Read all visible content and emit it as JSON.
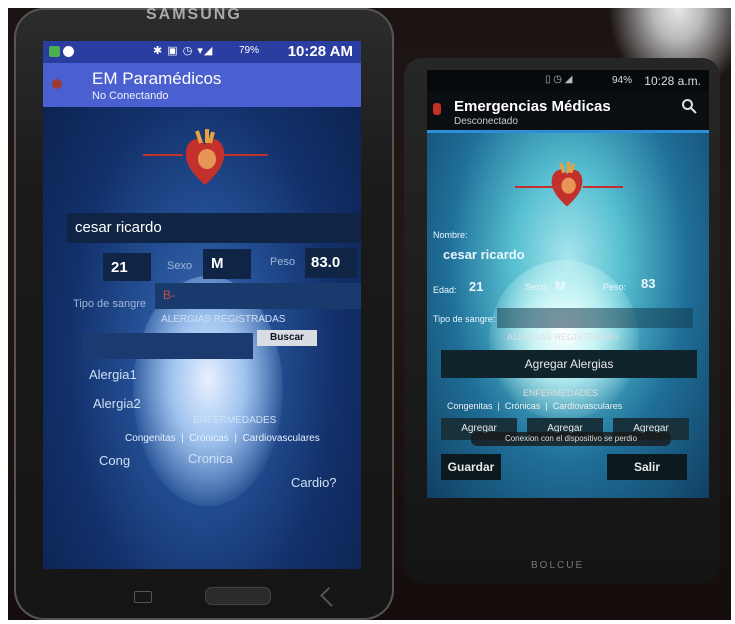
{
  "phone1": {
    "brand": "SAMSUNG",
    "status": {
      "icons": "✱ ▣ ◷ ▾◢",
      "battery": "79%",
      "time": "10:28 AM"
    },
    "appbar": {
      "title": "EM Paramédicos",
      "subtitle": "No Conectando"
    },
    "form": {
      "name_value": "cesar ricardo",
      "age_value": "21",
      "sex_label": "Sexo",
      "sex_value": "M",
      "weight_label": "Peso",
      "weight_value": "83.0",
      "blood_label": "Tipo de sangre",
      "blood_value": "B-",
      "allergies_caption": "ALERGIAS REGISTRADAS",
      "search_button": "Buscar",
      "allergy1": "Alergia1",
      "allergy2": "Alergia2",
      "diseases_caption": "ENFERMEDADES",
      "categories": "Congenitas  |  Crónicas  |  Cardiovasculares",
      "cong": "Cong",
      "cronica": "Cronica",
      "cardio": "Cardio?"
    }
  },
  "phone2": {
    "brand": "BOLCUE",
    "status": {
      "icons": "▯ ◷ ◢",
      "battery": "94%",
      "time": "10:28 a.m."
    },
    "appbar": {
      "title": "Emergencias Médicas",
      "subtitle": "Desconectado"
    },
    "form": {
      "name_label": "Nombre:",
      "name_value": "cesar ricardo",
      "age_label": "Edad:",
      "age_value": "21",
      "sex_label": "Sexo:",
      "sex_value": "M",
      "weight_label": "Peso:",
      "weight_value": "83",
      "blood_label": "Tipo de sangre:",
      "allergies_caption": "ALERGIAS REGISTRADAS",
      "add_allergies_button": "Agregar Alergias",
      "diseases_caption": "ENFERMEDADES",
      "categories": "Congenitas  |  Crónicas  |  Cardiovasculares",
      "add1": "Agregar",
      "add2": "Agregar",
      "add3": "Agregar",
      "toast": "Conexion con el dispositivo se perdio",
      "save_button": "Guardar",
      "exit_button": "Salir"
    }
  },
  "colors": {
    "phone1_appbar": "#4a5fd0",
    "phone1_statusbar": "#2a3da0",
    "phone2_accent": "#2d8fd8",
    "heart": "#c4302b"
  }
}
